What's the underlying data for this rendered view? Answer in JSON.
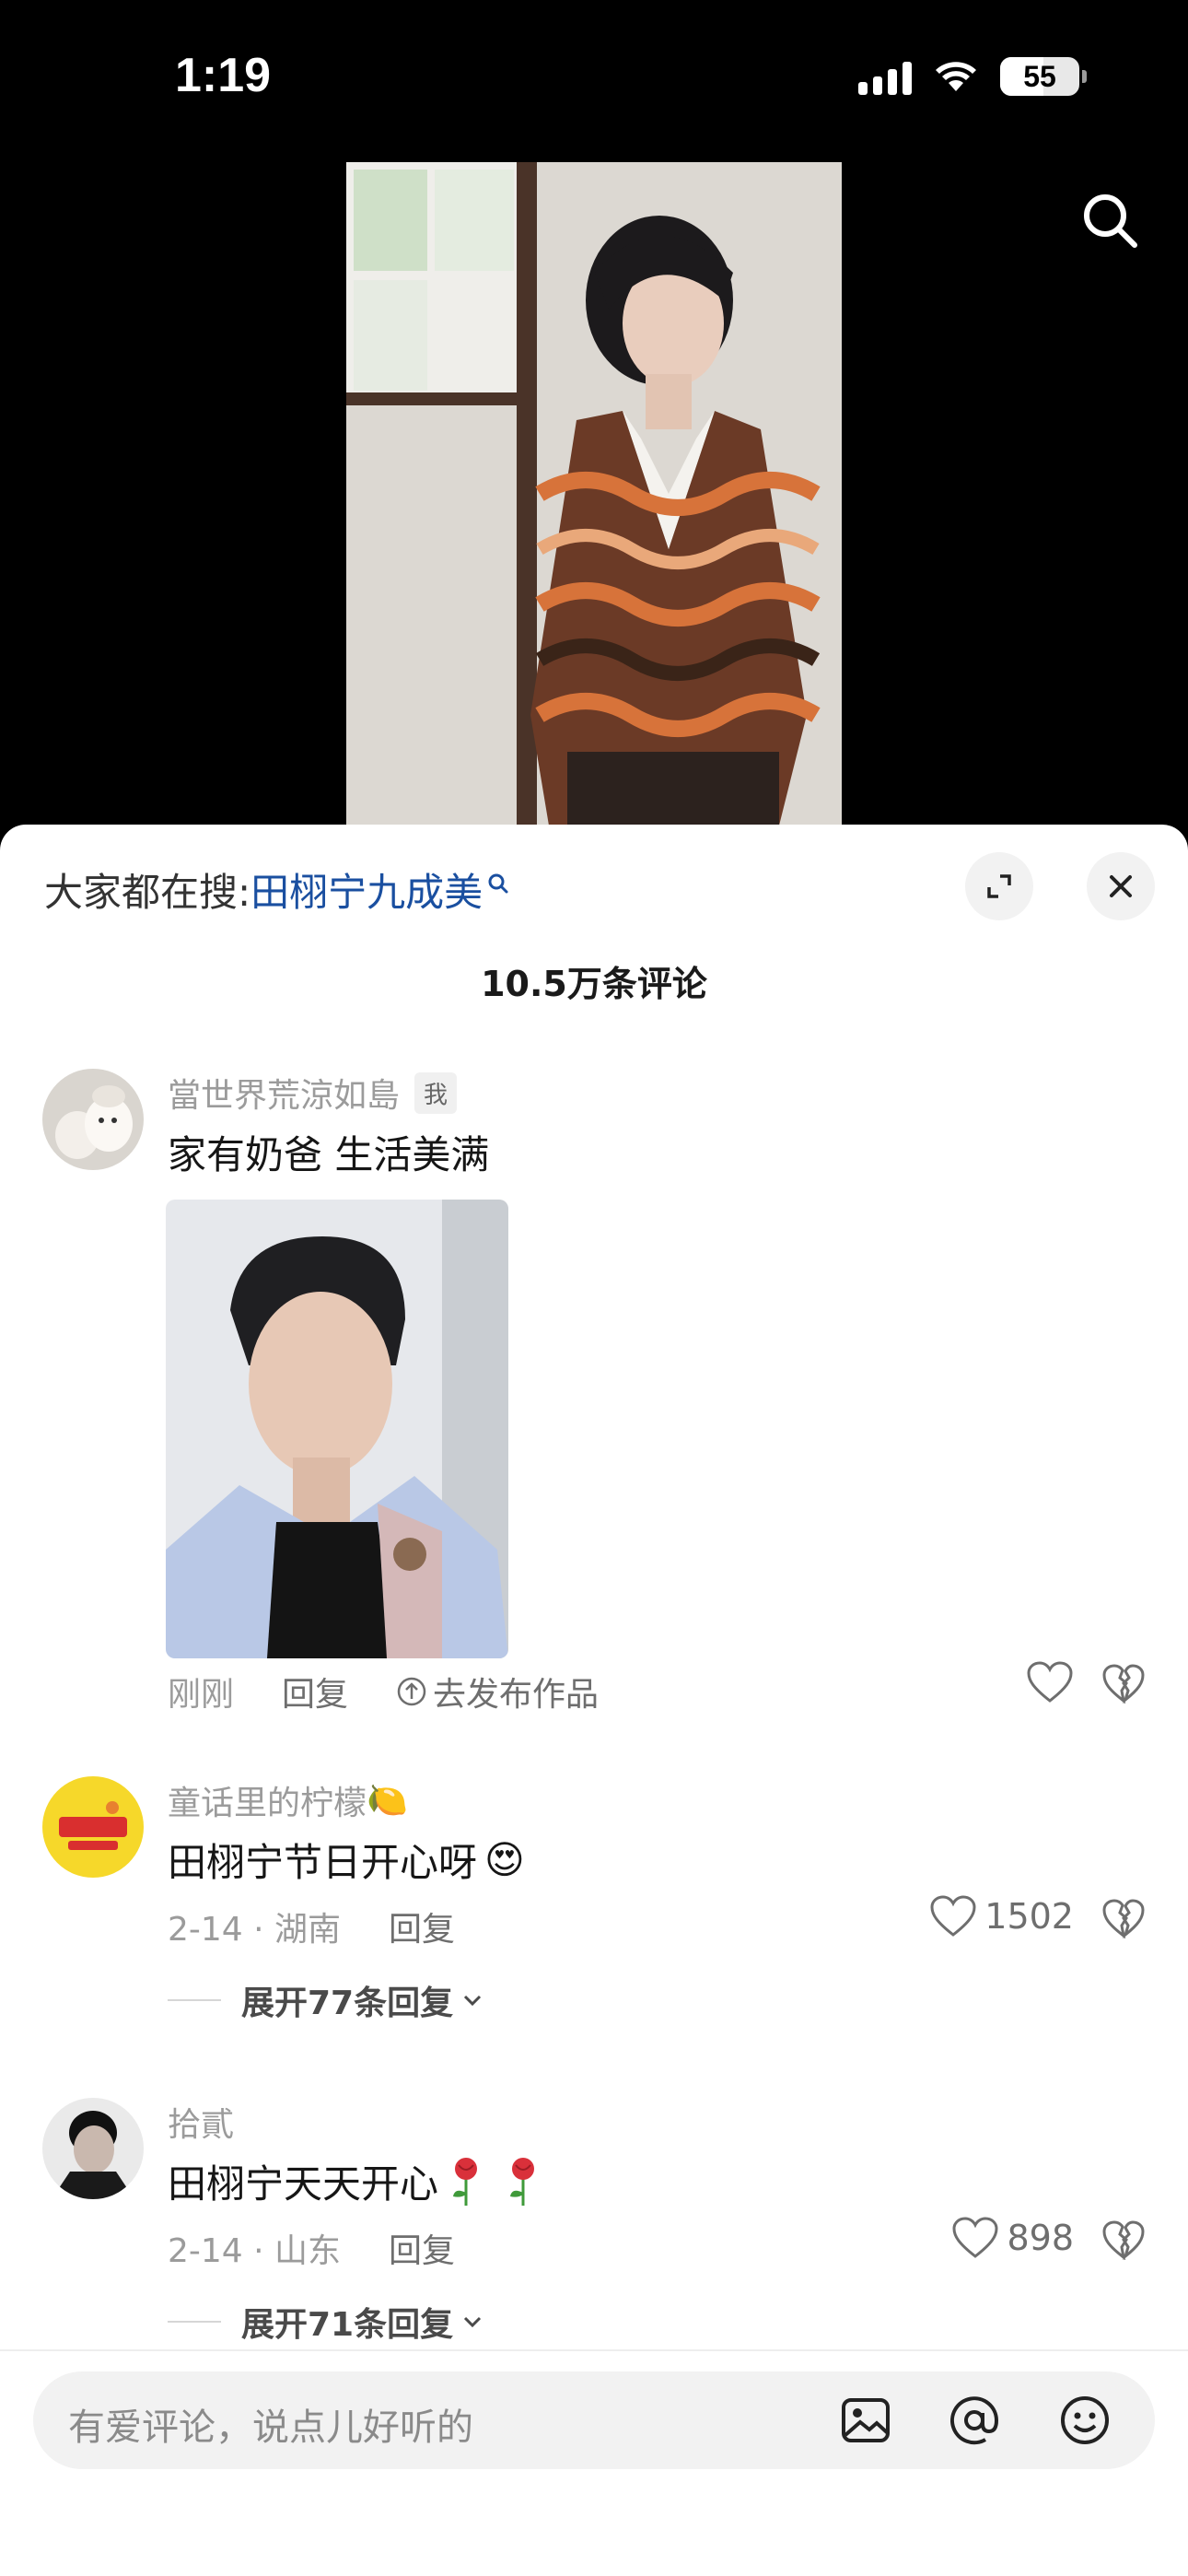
{
  "status_bar": {
    "time": "1:19",
    "battery_level": "55",
    "battery_fraction": 0.55
  },
  "header": {
    "trending_prefix": "大家都在搜:",
    "trending_keyword": "田栩宁九成美"
  },
  "comments_count": "10.5万条评论",
  "comments": [
    {
      "username": "當世界荒涼如島",
      "me_tag": "我",
      "text": "家有奶爸 生活美满",
      "time": "刚刚",
      "reply_label": "回复",
      "publish_label": "去发布作品"
    },
    {
      "username": "童话里的柠檬",
      "username_emoji": "🍋",
      "text": "田栩宁节日开心呀",
      "text_emoji": "😍",
      "date_location": "2-14 · 湖南",
      "reply_label": "回复",
      "likes": "1502",
      "expand_label": "展开77条回复"
    },
    {
      "username": "拾貳",
      "text": "田栩宁天天开心",
      "date_location": "2-14 · 山东",
      "reply_label": "回复",
      "likes": "898",
      "expand_label": "展开71条回复"
    }
  ],
  "input": {
    "placeholder": "有爱评论，说点儿好听的"
  },
  "icons": [
    "search-icon",
    "expand-icon",
    "close-icon",
    "heart-icon",
    "broken-heart-icon",
    "image-icon",
    "at-icon",
    "emoji-icon",
    "rose-icon",
    "chevron-down-icon",
    "publish-arrow-icon"
  ]
}
